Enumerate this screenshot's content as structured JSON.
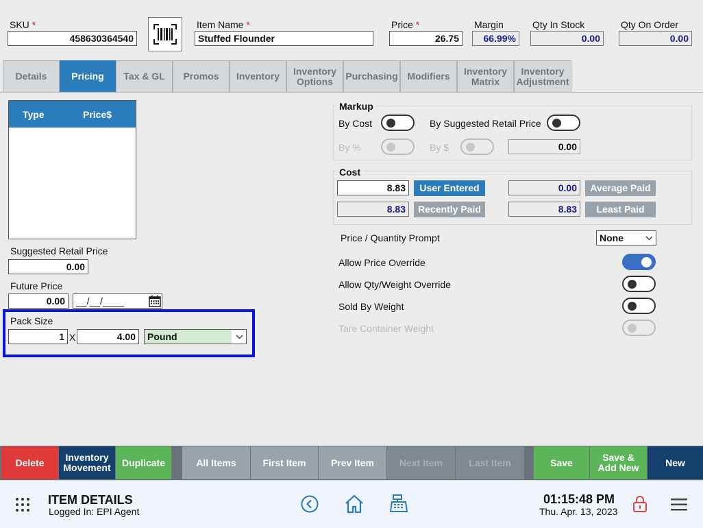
{
  "header": {
    "sku": {
      "label": "SKU",
      "required_mark": "*",
      "value": "458630364540"
    },
    "barcode_icon": "barcode-icon",
    "item_name": {
      "label": "Item Name",
      "required_mark": "*",
      "value": "Stuffed Flounder"
    },
    "price": {
      "label": "Price",
      "required_mark": "*",
      "value": "26.75"
    },
    "margin": {
      "label": "Margin",
      "value": "66.99%"
    },
    "qty_in_stock": {
      "label": "Qty In Stock",
      "value": "0.00"
    },
    "qty_on_order": {
      "label": "Qty On Order",
      "value": "0.00"
    }
  },
  "tabs": [
    {
      "label": "Details",
      "active": false
    },
    {
      "label": "Pricing",
      "active": true
    },
    {
      "label": "Tax & GL",
      "active": false
    },
    {
      "label": "Promos",
      "active": false
    },
    {
      "label": "Inventory",
      "active": false
    },
    {
      "label": "Inventory\nOptions",
      "active": false
    },
    {
      "label": "Purchasing",
      "active": false
    },
    {
      "label": "Modifiers",
      "active": false
    },
    {
      "label": "Inventory\nMatrix",
      "active": false
    },
    {
      "label": "Inventory\nAdjustment",
      "active": false
    }
  ],
  "price_table": {
    "col_type": "Type",
    "col_price": "Price$"
  },
  "suggested_retail": {
    "label": "Suggested Retail Price",
    "value": "0.00"
  },
  "future_price": {
    "label": "Future Price",
    "value": "0.00",
    "date": "__/__/____"
  },
  "pack_size": {
    "label": "Pack Size",
    "qty": "1",
    "x": "X",
    "size": "4.00",
    "unit": "Pound"
  },
  "markup": {
    "title": "Markup",
    "by_cost": "By Cost",
    "by_suggested": "By Suggested Retail Price",
    "by_percent": "By %",
    "by_dollar": "By $",
    "value": "0.00"
  },
  "cost": {
    "title": "Cost",
    "user_entered_value": "8.83",
    "user_entered_label": "User Entered",
    "average_value": "0.00",
    "average_label": "Average Paid",
    "recent_value": "8.83",
    "recent_label": "Recently Paid",
    "least_value": "8.83",
    "least_label": "Least Paid"
  },
  "options": {
    "price_qty_prompt": {
      "label": "Price / Quantity Prompt",
      "value": "None"
    },
    "allow_price_override": {
      "label": "Allow Price Override",
      "on": true
    },
    "allow_qty_override": {
      "label": "Allow Qty/Weight Override",
      "on": false
    },
    "sold_by_weight": {
      "label": "Sold By Weight",
      "on": false
    },
    "tare_weight": {
      "label": "Tare Container Weight",
      "on": false
    }
  },
  "actions": {
    "delete": "Delete",
    "inventory_movement": "Inventory\nMovement",
    "duplicate": "Duplicate",
    "all_items": "All Items",
    "first_item": "First Item",
    "prev_item": "Prev Item",
    "next_item": "Next Item",
    "last_item": "Last Item",
    "save": "Save",
    "save_add_new": "Save &\nAdd New",
    "new": "New"
  },
  "colors": {
    "accent_blue": "#2a7cba",
    "delete_red": "#e03a3a",
    "navy": "#14406e",
    "green": "#5db55a",
    "nav_gray": "#98a3ac",
    "highlight_blue": "#0a14e6"
  },
  "footer": {
    "title": "ITEM DETAILS",
    "logged_in": "Logged In:  EPI Agent",
    "time": "01:15:48 PM",
    "date": "Thu. Apr. 13, 2023"
  }
}
